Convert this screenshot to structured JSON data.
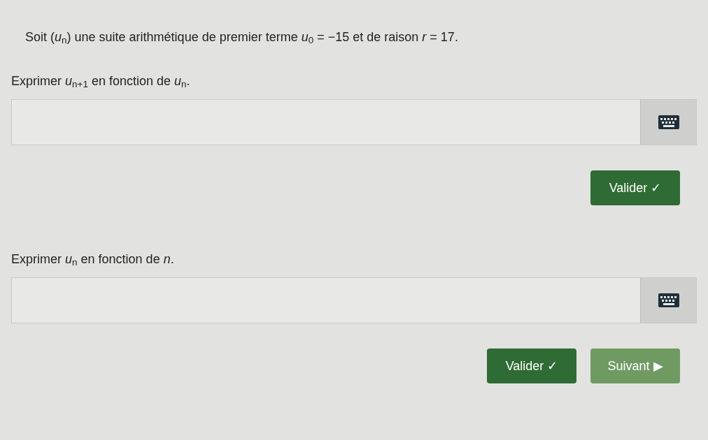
{
  "statement": "Soit (*u*$_{n}$) une suite arithmétique de premier terme *u*$_{0}$ = −15 et de raison *r* = 17.",
  "questions": [
    {
      "prompt": "Exprimer *u*$_{n+1}$ en fonction de *u*$_{n}$.",
      "buttons": [
        {
          "label": "Valider ✓",
          "kind": "validate"
        }
      ]
    },
    {
      "prompt": "Exprimer *u*$_{n}$ en fonction de *n*.",
      "buttons": [
        {
          "label": "Valider ✓",
          "kind": "validate"
        },
        {
          "label": "Suivant ▶",
          "kind": "next"
        }
      ]
    }
  ]
}
